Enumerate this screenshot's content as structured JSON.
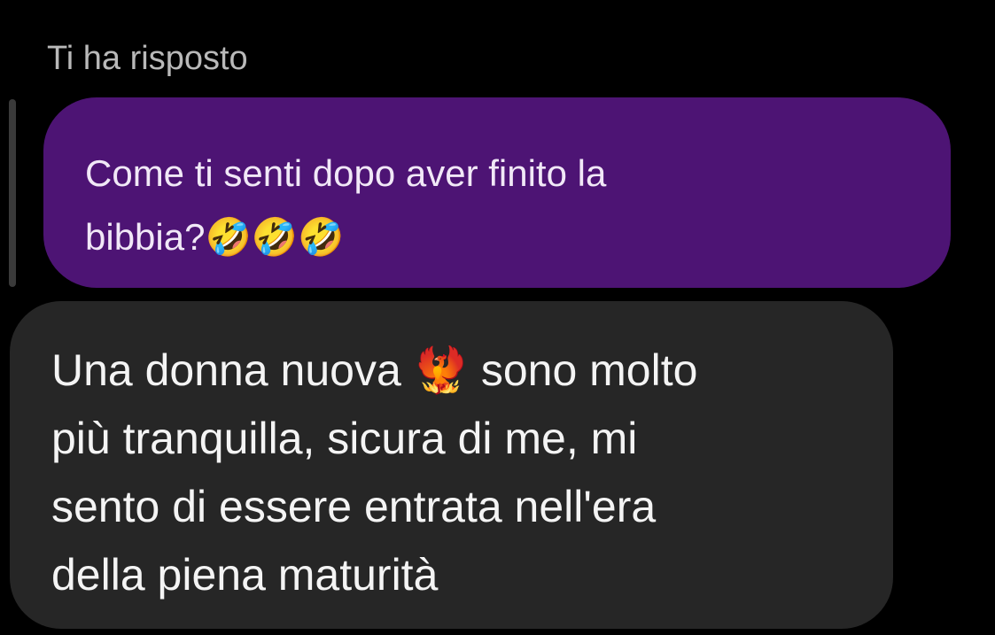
{
  "reply_header": {
    "label": "Ti ha risposto"
  },
  "quoted_message": {
    "text_line1": "Come ti senti dopo aver finito la",
    "text_line2": "bibbia?",
    "emoji": "🤣🤣🤣"
  },
  "reply_message": {
    "text_part1": "Una donna nuova ",
    "emoji": "🐦‍🔥",
    "text_part2": " sono molto",
    "text_line2": "più tranquilla, sicura di me, mi",
    "text_line3": "sento di essere entrata nell'era",
    "text_line4": "della piena maturità"
  },
  "colors": {
    "background": "#000000",
    "quoted_bubble": "#4d1474",
    "reply_bubble": "#262626",
    "label_text": "#b9b9b9"
  }
}
